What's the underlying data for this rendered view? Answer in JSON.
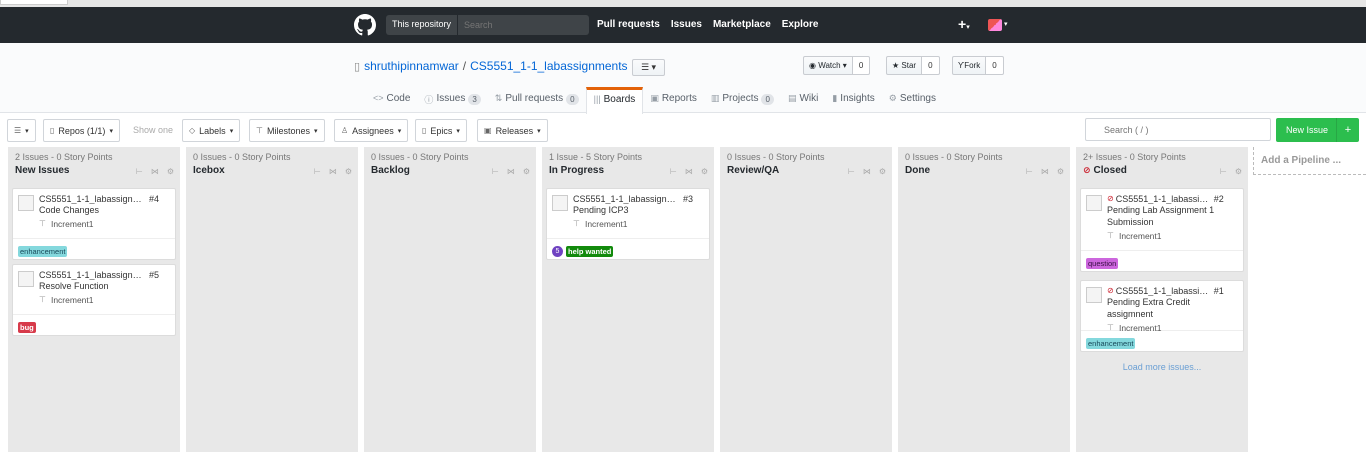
{
  "header": {
    "scope_label": "This repository",
    "search_placeholder": "Search",
    "nav": [
      "Pull requests",
      "Issues",
      "Marketplace",
      "Explore"
    ],
    "plus": "+"
  },
  "repo": {
    "owner": "shruthipinnamwar",
    "separator": "/",
    "name": "CS5551_1-1_labassignments",
    "list_toggle": "☰ ▾",
    "watch": {
      "label": "Watch ▾",
      "count": "0"
    },
    "star": {
      "label": "Star",
      "count": "0"
    },
    "fork": {
      "label": "Fork",
      "count": "0"
    },
    "tabs": [
      {
        "icon": "<>",
        "label": "Code"
      },
      {
        "icon": "ⓘ",
        "label": "Issues",
        "count": "3"
      },
      {
        "icon": "⇅",
        "label": "Pull requests",
        "count": "0"
      },
      {
        "icon": "|||",
        "label": "Boards"
      },
      {
        "icon": "▣",
        "label": "Reports"
      },
      {
        "icon": "▥",
        "label": "Projects",
        "count": "0"
      },
      {
        "icon": "▤",
        "label": "Wiki"
      },
      {
        "icon": "▮",
        "label": "Insights"
      },
      {
        "icon": "⚙",
        "label": "Settings"
      }
    ]
  },
  "toolbar": {
    "repos": "Repos (1/1)",
    "show_one": "Show one",
    "labels": "Labels",
    "milestones": "Milestones",
    "assignees": "Assignees",
    "epics": "Epics",
    "releases": "Releases",
    "search_placeholder": "Search ( / )",
    "new_issue": "New Issue",
    "new_issue_plus": "+"
  },
  "pipelines": [
    {
      "meta": "2 Issues - 0 Story Points",
      "name": "New Issues"
    },
    {
      "meta": "0 Issues - 0 Story Points",
      "name": "Icebox"
    },
    {
      "meta": "0 Issues - 0 Story Points",
      "name": "Backlog"
    },
    {
      "meta": "1 Issue - 5 Story Points",
      "name": "In Progress"
    },
    {
      "meta": "0 Issues - 0 Story Points",
      "name": "Review/QA"
    },
    {
      "meta": "0 Issues - 0 Story Points",
      "name": "Done"
    },
    {
      "meta": "2+ Issues - 0 Story Points",
      "name": "Closed"
    }
  ],
  "cards": {
    "c4": {
      "repo": "CS5551_1-1_labassignme...",
      "num": "#4",
      "title": "Code Changes",
      "milestone": "Increment1",
      "label": "enhancement"
    },
    "c5": {
      "repo": "CS5551_1-1_labassignme...",
      "num": "#5",
      "title": "Resolve Function",
      "milestone": "Increment1",
      "label": "bug"
    },
    "c3": {
      "repo": "CS5551_1-1_labassignme...",
      "num": "#3",
      "title": "Pending ICP3",
      "milestone": "Increment1",
      "estimate": "5",
      "label": "help wanted"
    },
    "c2": {
      "repo": "CS5551_1-1_labassign...",
      "num": "#2",
      "title_line1": "Pending Lab Assignment 1",
      "title_line2": "Submission",
      "milestone": "Increment1",
      "label": "question"
    },
    "c1": {
      "repo": "CS5551_1-1_labassign...",
      "num": "#1",
      "title": "Pending Extra Credit assigmnent",
      "milestone": "Increment1",
      "label": "enhancement"
    }
  },
  "load_more": "Load more issues...",
  "add_pipeline": "Add a Pipeline ...",
  "colors": {
    "enhancement": "#84d8dd",
    "bug": "#d73a4a",
    "help_wanted": "#128a0c",
    "question": "#cc66dd",
    "new_issue_green": "#2cbe4e"
  }
}
